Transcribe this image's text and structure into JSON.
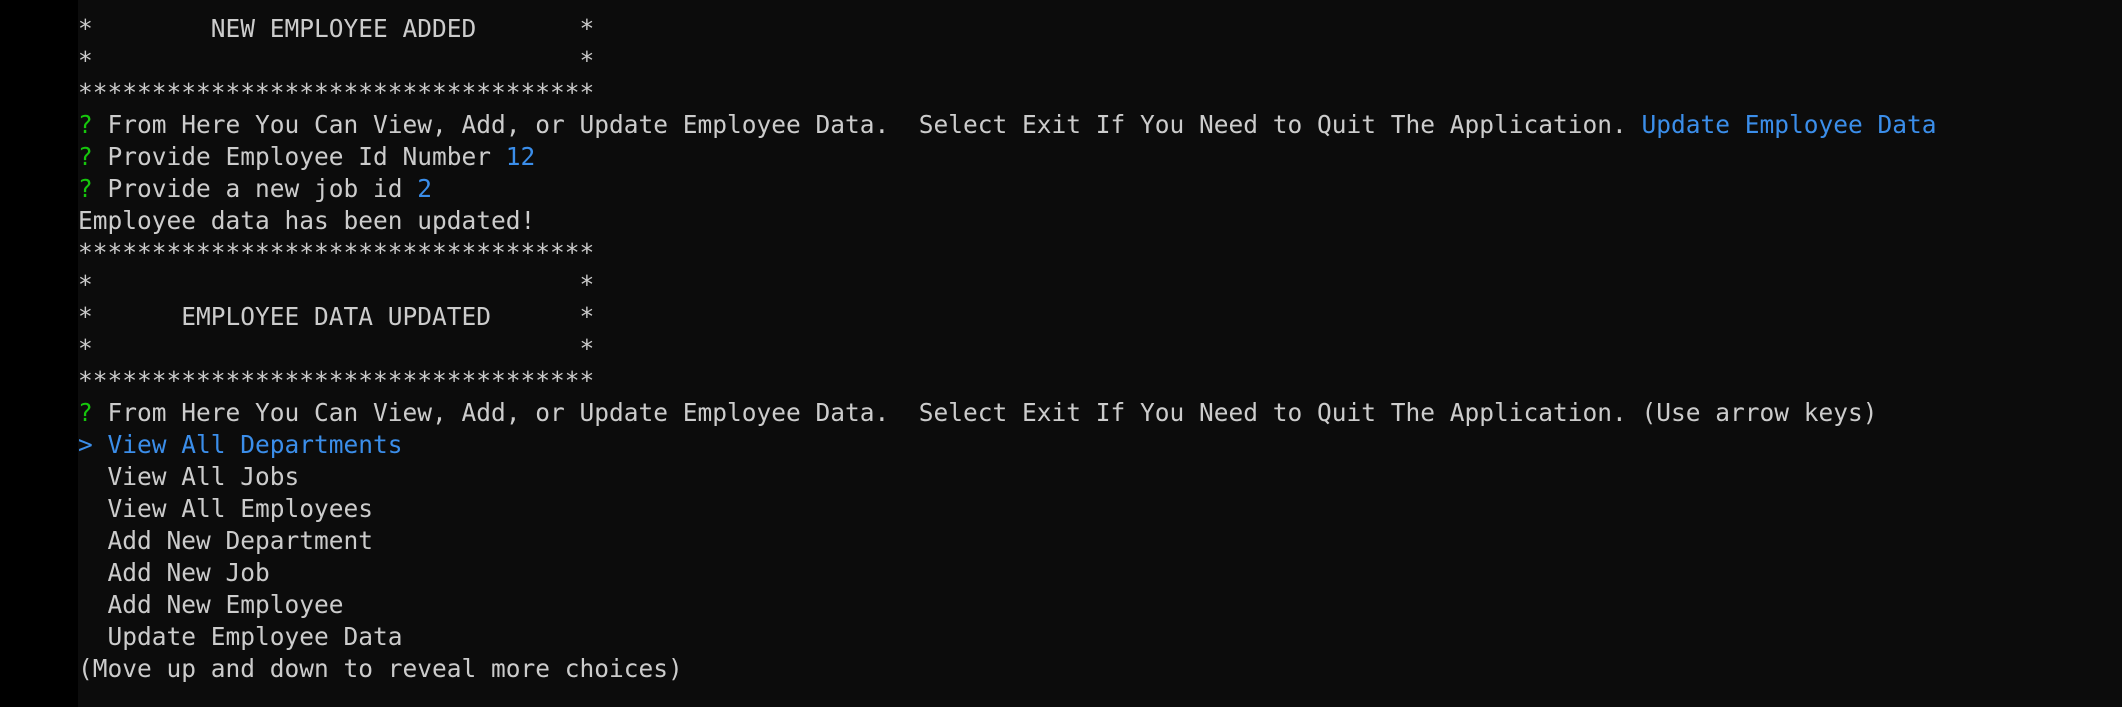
{
  "colors": {
    "background": "#0c0c0c",
    "text": "#cccccc",
    "prompt_marker": "#16c60c",
    "answer": "#3b8eea"
  },
  "terminal": {
    "lines": {
      "banner1_middle": "*        NEW EMPLOYEE ADDED       *",
      "banner1_blank": "*                                 *",
      "banner1_border": "***********************************",
      "prompt1_marker": "?",
      "prompt1_text": " From Here You Can View, Add, or Update Employee Data.  Select Exit If You Need to Quit The Application. ",
      "prompt1_answer": "Update Employee Data",
      "prompt2_marker": "?",
      "prompt2_text": " Provide Employee Id Number ",
      "prompt2_answer": "12",
      "prompt3_marker": "?",
      "prompt3_text": " Provide a new job id ",
      "prompt3_answer": "2",
      "status_message": "Employee data has been updated!",
      "banner2_border_top": "***********************************",
      "banner2_blank_top": "*                                 *",
      "banner2_middle": "*      EMPLOYEE DATA UPDATED      *",
      "banner2_blank_bottom": "*                                 *",
      "banner2_border_bottom": "***********************************",
      "prompt4_marker": "?",
      "prompt4_text": " From Here You Can View, Add, or Update Employee Data.  Select Exit If You Need to Quit The Application. (Use arrow keys)"
    },
    "menu": {
      "pointer": ">",
      "items": [
        "View All Departments",
        "View All Jobs",
        "View All Employees",
        "Add New Department",
        "Add New Job",
        "Add New Employee",
        "Update Employee Data"
      ],
      "hint": "(Move up and down to reveal more choices)"
    }
  }
}
